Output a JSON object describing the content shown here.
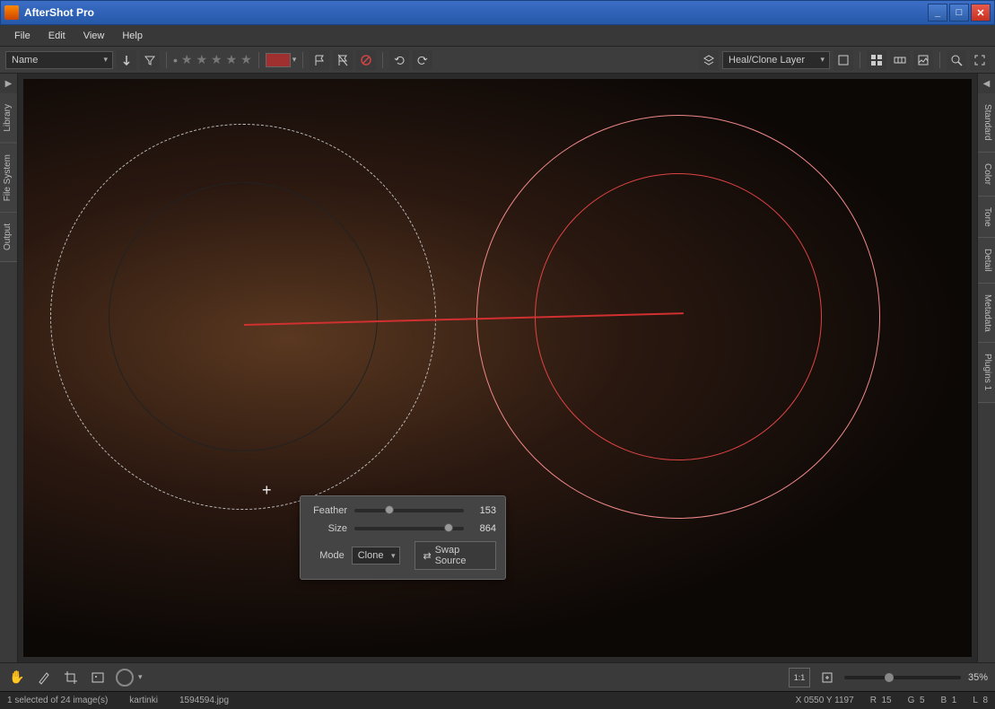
{
  "window": {
    "title": "AfterShot Pro"
  },
  "menu": {
    "file": "File",
    "edit": "Edit",
    "view": "View",
    "help": "Help"
  },
  "toolbar": {
    "sort": "Name",
    "layer_select": "Heal/Clone Layer"
  },
  "left_tabs": {
    "library": "Library",
    "filesystem": "File System",
    "output": "Output"
  },
  "right_tabs": {
    "standard": "Standard",
    "color": "Color",
    "tone": "Tone",
    "detail": "Detail",
    "metadata": "Metadata",
    "plugins": "Plugins 1"
  },
  "popup": {
    "feather_label": "Feather",
    "feather_value": "153",
    "size_label": "Size",
    "size_value": "864",
    "mode_label": "Mode",
    "mode_value": "Clone",
    "swap_btn": "Swap Source"
  },
  "zoom": {
    "value": "35%"
  },
  "status": {
    "selection": "1 selected of 24 image(s)",
    "folder": "kartinki",
    "filename": "1594594.jpg",
    "coords": "X 0550  Y 1197",
    "r_label": "R",
    "r": "15",
    "g_label": "G",
    "g": "5",
    "b_label": "B",
    "b": "1",
    "l_label": "L",
    "l": "8"
  }
}
